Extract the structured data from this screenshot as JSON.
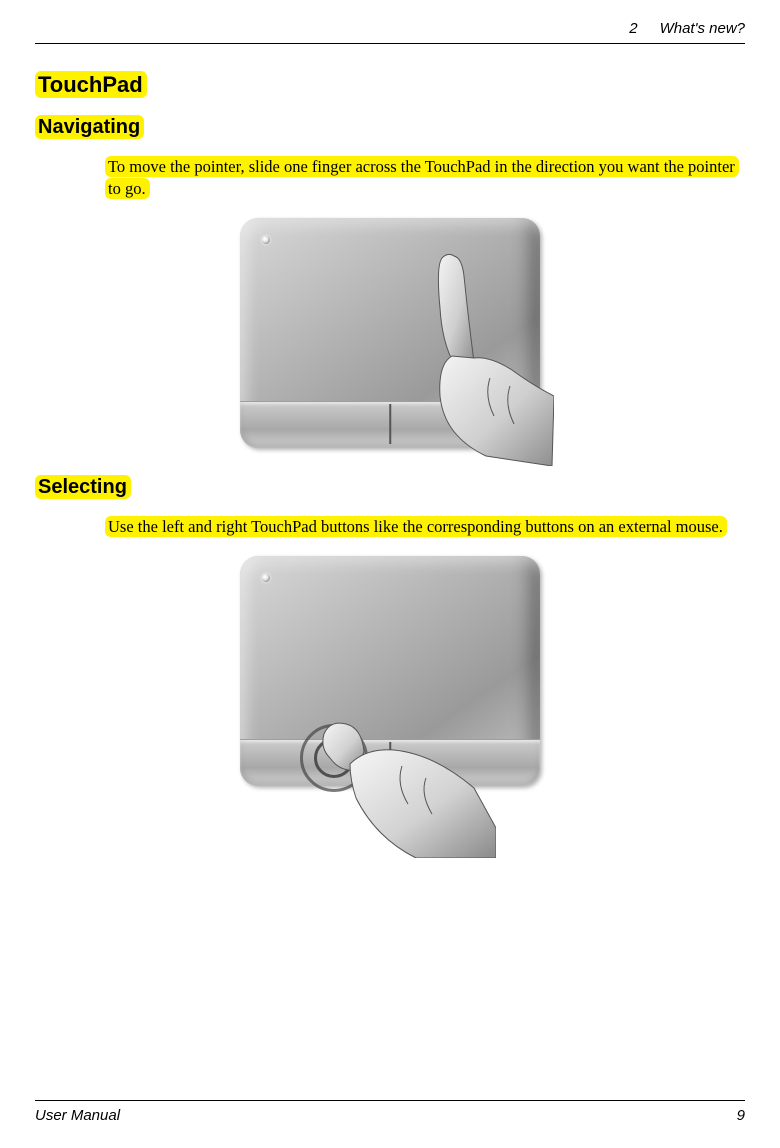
{
  "header": {
    "chapter_number": "2",
    "chapter_title": "What's new?"
  },
  "sections": {
    "touchpad_heading": "TouchPad",
    "navigating": {
      "heading": "Navigating",
      "body": "To move the pointer, slide one finger across the TouchPad in the direction you want the pointer to go."
    },
    "selecting": {
      "heading": "Selecting",
      "body": "Use the left and right TouchPad buttons like the corresponding buttons on an external mouse."
    }
  },
  "footer": {
    "doc_title": "User Manual",
    "page_number": "9"
  }
}
